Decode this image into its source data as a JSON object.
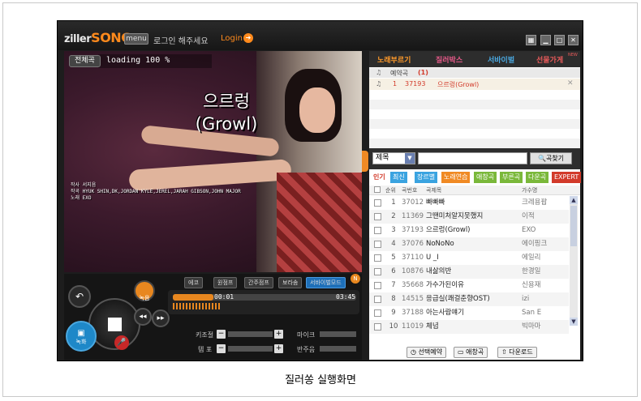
{
  "app": {
    "logo_prefix": "ziller",
    "logo_suffix": "SONG",
    "menu_label": "menu",
    "login_message": "로그인 해주세요",
    "login_link": "Login",
    "login_icon": "arrow-right-circle-icon"
  },
  "window_controls": [
    "grid-icon",
    "minimize-icon",
    "maximize-icon",
    "close-icon"
  ],
  "player": {
    "status_label": "전체곡",
    "loading_text": "loading 100 %",
    "lyric_line1": "으르렁",
    "lyric_line2": "(Growl)",
    "credits": [
      "작사 서지음",
      "작곡 HYUK SHIN,DK,JORDAN KYLE,JEREL,JARAH GIBSON,JOHN MAJOR",
      "노래 EXO"
    ],
    "mode_buttons": [
      "에코",
      "원점프",
      "간주점프",
      "보라솜",
      "서바이벌모드"
    ],
    "mode_badge": "N",
    "time_current": "00:01",
    "time_total": "03:45",
    "record_label": "녹음",
    "record2_label": "녹화",
    "key_label": "키조절",
    "tempo_label": "템 포",
    "mic_label": "마이크",
    "accompaniment_label": "반주음"
  },
  "panel": {
    "tabs": [
      "노래부르기",
      "질러박스",
      "서바이벌",
      "선물가게"
    ],
    "tab_badge": "NEW",
    "reserve_header": "예약곡",
    "reserve_count": "(1)",
    "reserve_item": {
      "index": "1",
      "code": "37193",
      "title": "으르렁(Growl)"
    },
    "search_select": "제목",
    "search_button": "곡찾기",
    "categories": [
      {
        "label": "인기",
        "color": "#ffffff",
        "text": "#d23a2a"
      },
      {
        "label": "최신",
        "color": "#3aa3e0",
        "text": "#ffffff"
      },
      {
        "label": "장르별",
        "color": "#3aa3e0",
        "text": "#ffffff"
      },
      {
        "label": "노래연습",
        "color": "#f08a24",
        "text": "#ffffff"
      },
      {
        "label": "애창곡",
        "color": "#7ab83a",
        "text": "#ffffff"
      },
      {
        "label": "부른곡",
        "color": "#7ab83a",
        "text": "#ffffff"
      },
      {
        "label": "다운곡",
        "color": "#7ab83a",
        "text": "#ffffff"
      },
      {
        "label": "EXPERT",
        "color": "#d23a2a",
        "text": "#ffffff"
      }
    ],
    "list_headers": [
      "순위",
      "곡번호",
      "곡제목",
      "가수명"
    ],
    "songs": [
      {
        "rank": "1",
        "code": "37012",
        "title": "빠빠빠",
        "artist": "크레용팝"
      },
      {
        "rank": "2",
        "code": "11369",
        "title": "그땐미처알지못했지",
        "artist": "이적"
      },
      {
        "rank": "3",
        "code": "37193",
        "title": "으르렁(Growl)",
        "artist": "EXO"
      },
      {
        "rank": "4",
        "code": "37076",
        "title": "NoNoNo",
        "artist": "에이핑크"
      },
      {
        "rank": "5",
        "code": "37110",
        "title": "U _I",
        "artist": "에일리"
      },
      {
        "rank": "6",
        "code": "10876",
        "title": "내삶의반",
        "artist": "한경일"
      },
      {
        "rank": "7",
        "code": "35668",
        "title": "가수가된이유",
        "artist": "신용재"
      },
      {
        "rank": "8",
        "code": "14515",
        "title": "응급실(쾌걸춘향OST)",
        "artist": "izi"
      },
      {
        "rank": "9",
        "code": "37188",
        "title": "아는사람얘기",
        "artist": "San E"
      },
      {
        "rank": "10",
        "code": "11019",
        "title": "체념",
        "artist": "빅마마"
      }
    ],
    "bottom_buttons": [
      "선택예약",
      "애창곡",
      "다운로드"
    ]
  },
  "caption": "질러쏭 실행화면"
}
